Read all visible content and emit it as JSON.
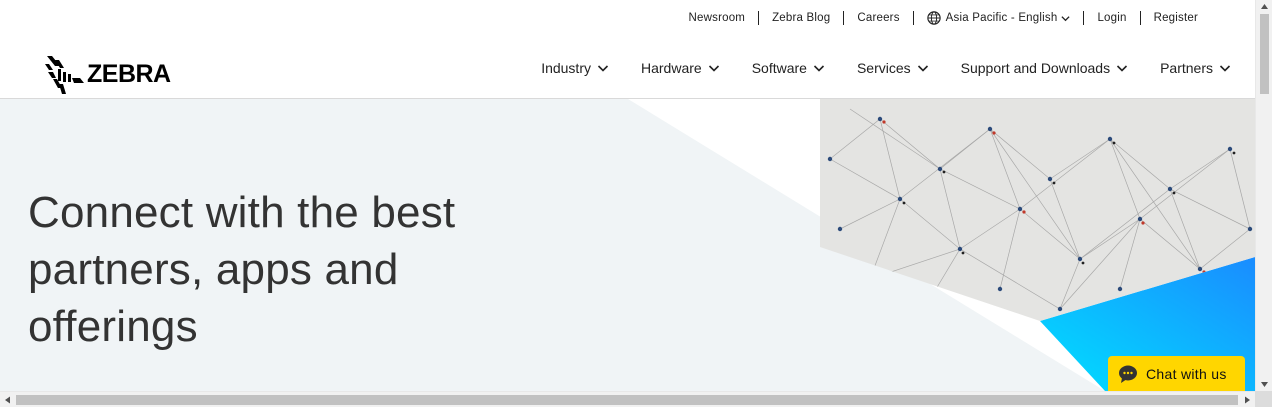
{
  "utility": {
    "links": [
      "Newsroom",
      "Zebra Blog",
      "Careers"
    ],
    "region": "Asia Pacific - English",
    "login": "Login",
    "register": "Register"
  },
  "logo": {
    "text": "ZEBRA",
    "icon": "zebra-head-icon"
  },
  "nav": {
    "items": [
      "Industry",
      "Hardware",
      "Software",
      "Services",
      "Support and Downloads",
      "Partners"
    ]
  },
  "hero": {
    "title_lines": [
      "Connect with the best",
      "partners, apps and",
      "offerings"
    ]
  },
  "chat": {
    "label": "Chat with us",
    "icon": "chat-bubble-icon"
  },
  "colors": {
    "hero_bg": "#f0f4f6",
    "chat_bg": "#ffd600",
    "cyan_accent": "#00c8f8",
    "text": "#333333"
  }
}
